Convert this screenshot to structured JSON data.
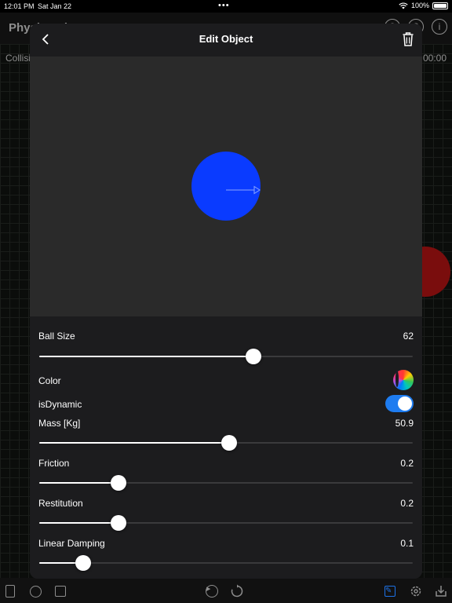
{
  "status_bar": {
    "time": "12:01 PM",
    "date": "Sat Jan 22",
    "battery": "100%"
  },
  "background": {
    "app_title": "Physics Sheet",
    "collisions_label": "Collisions",
    "timer": "00:00"
  },
  "modal": {
    "title": "Edit Object",
    "ball_color": "#0a3bff",
    "controls": {
      "ball_size": {
        "label": "Ball Size",
        "value": "62",
        "fraction": 0.577
      },
      "color": {
        "label": "Color"
      },
      "is_dynamic": {
        "label": "isDynamic",
        "on": true
      },
      "mass": {
        "label": "Mass [Kg]",
        "value": "50.9",
        "fraction": 0.509
      },
      "friction": {
        "label": "Friction",
        "value": "0.2",
        "fraction": 0.2
      },
      "restitution": {
        "label": "Restitution",
        "value": "0.2",
        "fraction": 0.2
      },
      "linear_damping": {
        "label": "Linear Damping",
        "value": "0.1",
        "fraction": 0.1
      }
    }
  },
  "colors": {
    "accent": "#1e73e8",
    "toggle_on": "#1e7cf0",
    "background_ball": "#7a0d0d"
  }
}
